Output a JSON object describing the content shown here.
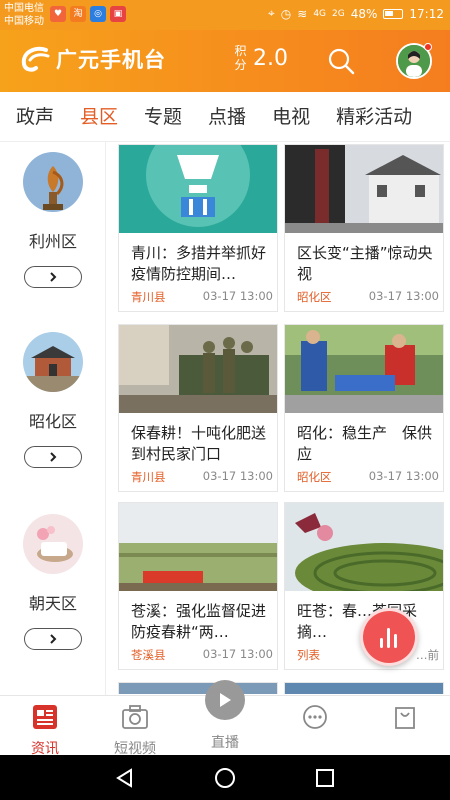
{
  "status_bar": {
    "carrier1": "中国电信",
    "carrier2": "中国移动",
    "network1": "4G",
    "network2": "2G",
    "battery": "48%",
    "time": "17:12"
  },
  "header": {
    "app_name": "广元手机台",
    "points_label": "积分",
    "points_value": "2.0"
  },
  "tabs": [
    {
      "label": "政声"
    },
    {
      "label": "县区"
    },
    {
      "label": "专题"
    },
    {
      "label": "点播"
    },
    {
      "label": "电视"
    },
    {
      "label": "精彩活动"
    }
  ],
  "active_tab": "县区",
  "sidebar": {
    "districts": [
      {
        "name": "利州区"
      },
      {
        "name": "昭化区"
      },
      {
        "name": "朝天区"
      }
    ]
  },
  "cards": [
    {
      "title": "青川：多措并举抓好疫情防控期间…",
      "district": "青川县",
      "time": "03-17 13:00"
    },
    {
      "title": "区长变“主播”惊动央视",
      "district": "昭化区",
      "time": "03-17 13:00"
    },
    {
      "title": "保春耕！十吨化肥送到村民家门口",
      "district": "青川县",
      "time": "03-17 13:00"
    },
    {
      "title": "昭化：稳生产　保供应",
      "district": "昭化区",
      "time": "03-17 13:00"
    },
    {
      "title": "苍溪：强化监督促进防疫春耕“两…",
      "district": "苍溪县",
      "time": "03-17 13:00"
    },
    {
      "title": "旺苍：春…茶园采摘…",
      "district": "列表",
      "time": "…前"
    }
  ],
  "bottom_nav": [
    {
      "label": "资讯",
      "icon": "news-icon"
    },
    {
      "label": "短视频",
      "icon": "camera-icon"
    },
    {
      "label": "直播",
      "icon": "play-icon"
    },
    {
      "label": "",
      "icon": "chat-icon"
    },
    {
      "label": "",
      "icon": "bag-icon"
    }
  ],
  "colors": {
    "brand": "#f39a1f",
    "accent": "#e35d25",
    "float_button": "#f05353"
  }
}
